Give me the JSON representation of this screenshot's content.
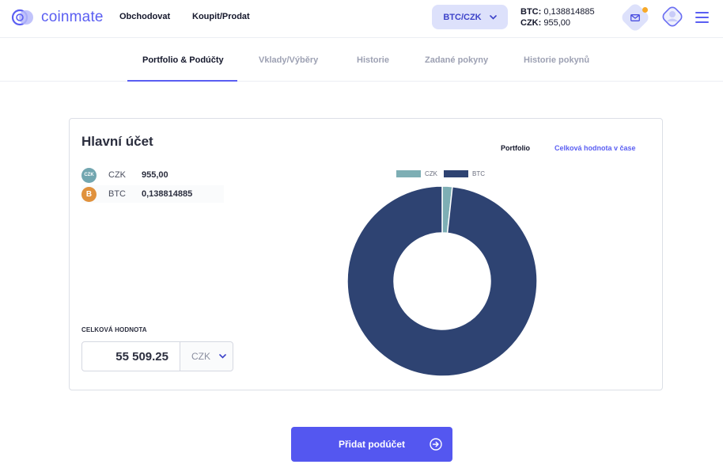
{
  "header": {
    "brand": "coinmate",
    "nav": [
      {
        "label": "Obchodovat"
      },
      {
        "label": "Koupit/Prodat"
      }
    ],
    "pair_selector": "BTC/CZK",
    "balances": [
      {
        "currency": "BTC:",
        "amount": "0,138814885"
      },
      {
        "currency": "CZK:",
        "amount": "955,00"
      }
    ],
    "icons": [
      "logo-icon",
      "chevron-down-icon",
      "mail-icon",
      "avatar-icon",
      "hamburger-icon"
    ],
    "notification_dot_color": "#f7a928"
  },
  "tabs": [
    {
      "label": "Portfolio & Podúčty",
      "active": true
    },
    {
      "label": "Vklady/Výběry",
      "active": false
    },
    {
      "label": "Historie",
      "active": false
    },
    {
      "label": "Zadané pokyny",
      "active": false
    },
    {
      "label": "Historie pokynů",
      "active": false
    }
  ],
  "account": {
    "title": "Hlavní účet",
    "view_toggle": {
      "portfolio": "Portfolio",
      "value_over_time": "Celková hodnota v čase"
    },
    "assets": [
      {
        "icon": "czk-coin-icon",
        "icon_text": "CZK",
        "code": "CZK",
        "amount": "955,00"
      },
      {
        "icon": "btc-coin-icon",
        "icon_text": "B",
        "code": "BTC",
        "amount": "0,138814885"
      }
    ],
    "total_label": "CELKOVÁ HODNOTA",
    "total_value": "55 509.25",
    "total_currency": "CZK"
  },
  "chart_data": {
    "type": "pie",
    "donut": true,
    "legend_placement": "top",
    "series": [
      {
        "name": "CZK",
        "value": 955.0,
        "color": "#7daeb4"
      },
      {
        "name": "BTC",
        "value": 54554.25,
        "color": "#2e4372"
      }
    ]
  },
  "actions": {
    "add_subaccount": "Přidat podúčet"
  },
  "colors": {
    "accent": "#5a5ef2",
    "primary_button": "#5457f0",
    "pair_button_bg": "#dde1fb"
  }
}
